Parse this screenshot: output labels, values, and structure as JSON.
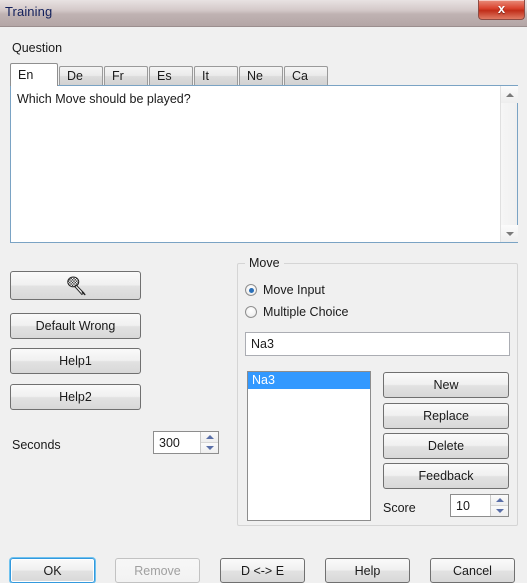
{
  "window": {
    "title": "Training",
    "close_icon": "close-x-icon",
    "close_label": "x"
  },
  "question": {
    "section_label": "Question",
    "tabs": [
      {
        "label": "En",
        "active": true
      },
      {
        "label": "De",
        "active": false
      },
      {
        "label": "Fr",
        "active": false
      },
      {
        "label": "Es",
        "active": false
      },
      {
        "label": "It",
        "active": false
      },
      {
        "label": "Ne",
        "active": false
      },
      {
        "label": "Ca",
        "active": false
      }
    ],
    "text": "Which Move should be played?"
  },
  "left_panel": {
    "record_button_icon": "microphone-icon",
    "default_wrong_label": "Default Wrong",
    "help1_label": "Help1",
    "help2_label": "Help2",
    "seconds_label": "Seconds",
    "seconds_value": "300"
  },
  "move_group": {
    "title": "Move",
    "radio_move_input_label": "Move Input",
    "radio_multiple_choice_label": "Multiple Choice",
    "move_input_selected": true,
    "answer_value": "Na3",
    "answers": [
      {
        "label": "Na3",
        "selected": true
      }
    ],
    "new_label": "New",
    "replace_label": "Replace",
    "delete_label": "Delete",
    "feedback_label": "Feedback",
    "score_label": "Score",
    "score_value": "10"
  },
  "footer": {
    "ok_label": "OK",
    "remove_label": "Remove",
    "remove_disabled": true,
    "de_label": "D <-> E",
    "help_label": "Help",
    "cancel_label": "Cancel"
  },
  "colors": {
    "accent_selection": "#3399ff",
    "focus_ring": "#3399dd",
    "close_red": "#d9412c",
    "dialog_bg": "#f0f0f0",
    "title_text": "#12205c"
  }
}
